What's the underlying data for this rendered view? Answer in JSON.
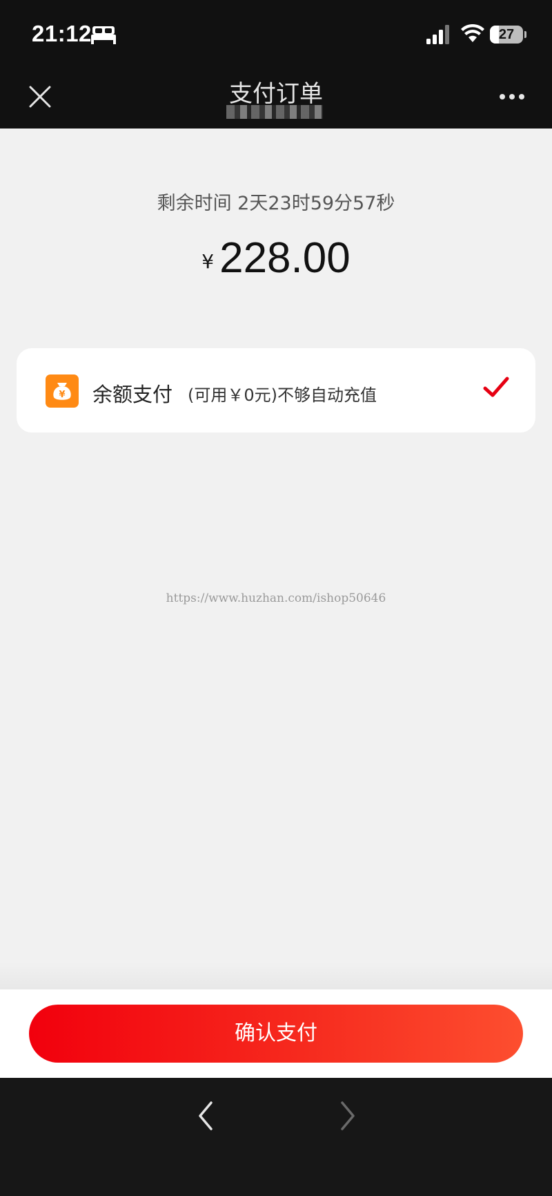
{
  "status_bar": {
    "time": "21:12",
    "battery_level": "27",
    "icons": [
      "bed-icon",
      "signal-icon",
      "wifi-icon",
      "battery-icon"
    ]
  },
  "nav": {
    "title": "支付订单",
    "close_icon": "close-icon",
    "more_icon": "more-icon"
  },
  "order": {
    "countdown": "剩余时间 2天23时59分57秒",
    "currency_symbol": "¥",
    "amount": "228.00"
  },
  "payment_method": {
    "label": "余额支付",
    "note": "(可用￥0元)不够自动充值",
    "icon": "wallet-icon",
    "selected": true
  },
  "watermark": "https://www.huzhan.com/ishop50646",
  "confirm_button": {
    "label": "确认支付"
  },
  "browser_bar": {
    "back_icon": "chevron-left-icon",
    "forward_icon": "chevron-right-icon"
  },
  "colors": {
    "accent_red": "#f2000d",
    "accent_orange": "#fd4e2f",
    "wallet_orange": "#ff8a14",
    "check_red": "#e60012",
    "dark_bar": "#111111"
  }
}
